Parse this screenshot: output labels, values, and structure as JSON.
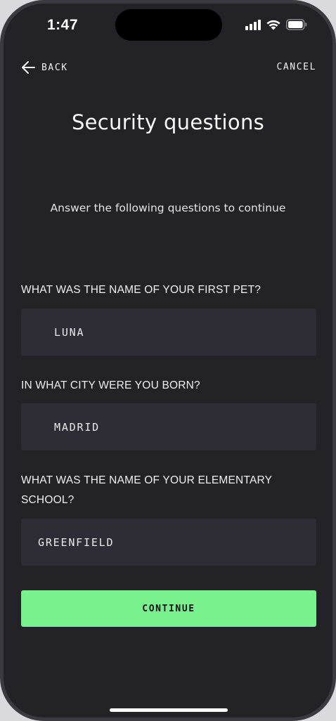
{
  "status_bar": {
    "time": "1:47"
  },
  "nav": {
    "back_label": "BACK",
    "cancel_label": "CANCEL"
  },
  "title": "Security questions",
  "subtitle": "Answer the following questions to continue",
  "questions": [
    {
      "question": "WHAT WAS THE NAME OF YOUR FIRST PET?",
      "answer": "LUNA"
    },
    {
      "question": "IN WHAT CITY WERE YOU BORN?",
      "answer": "MADRID"
    },
    {
      "question": "WHAT WAS THE NAME OF YOUR ELEMENTARY SCHOOL?",
      "answer": "GREENFIELD"
    }
  ],
  "continue_label": "CONTINUE",
  "colors": {
    "background": "#232227",
    "field": "#2e2d36",
    "accent": "#79f28d"
  }
}
